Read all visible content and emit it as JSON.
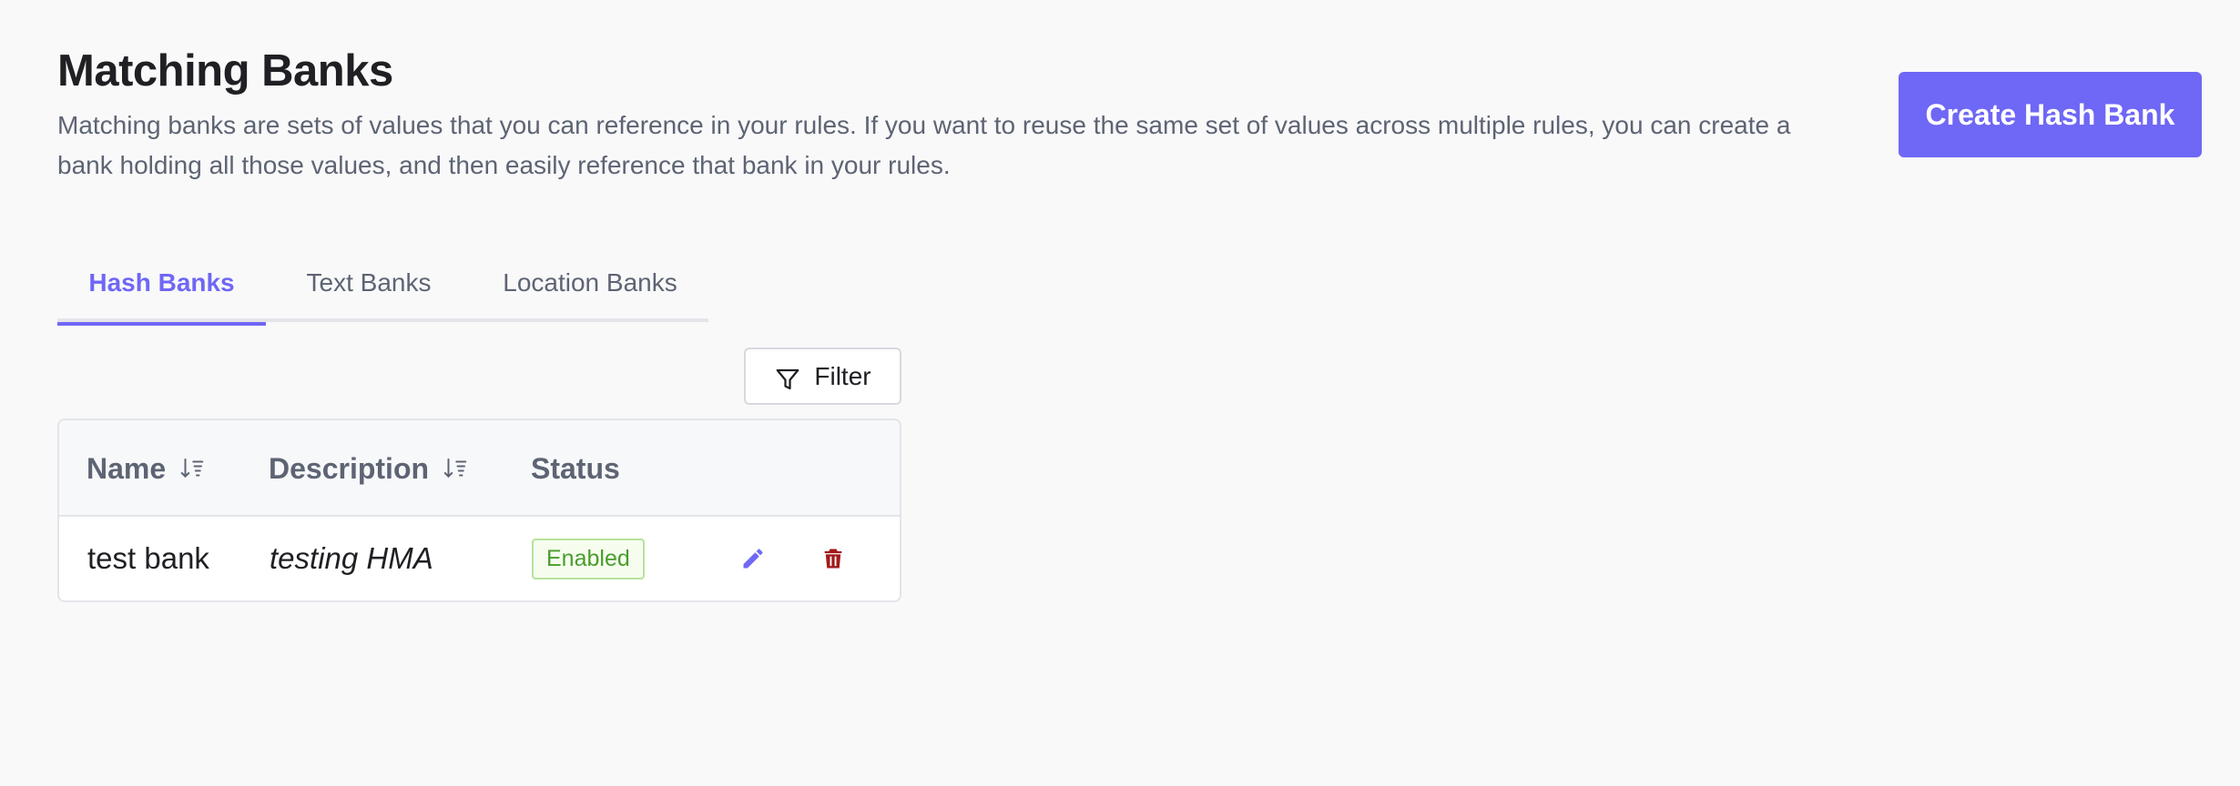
{
  "header": {
    "title": "Matching Banks",
    "description": "Matching banks are sets of values that you can reference in your rules. If you want to reuse the same set of values across multiple rules, you can create a bank holding all those values, and then easily reference that bank in your rules."
  },
  "actions": {
    "create_label": "Create Hash Bank"
  },
  "tabs": [
    {
      "label": "Hash Banks",
      "active": true
    },
    {
      "label": "Text Banks",
      "active": false
    },
    {
      "label": "Location Banks",
      "active": false
    }
  ],
  "filter": {
    "label": "Filter"
  },
  "table": {
    "columns": {
      "name": "Name",
      "description": "Description",
      "status": "Status"
    },
    "rows": [
      {
        "name": "test bank",
        "description": "testing HMA",
        "status": "Enabled"
      }
    ]
  },
  "colors": {
    "accent": "#6f67f5",
    "success": "#4a9d2c",
    "danger": "#a11a1a"
  },
  "icons": {
    "sort": "sort-descending-icon",
    "filter": "filter-funnel-icon",
    "edit": "pencil-icon",
    "delete": "trash-icon"
  }
}
